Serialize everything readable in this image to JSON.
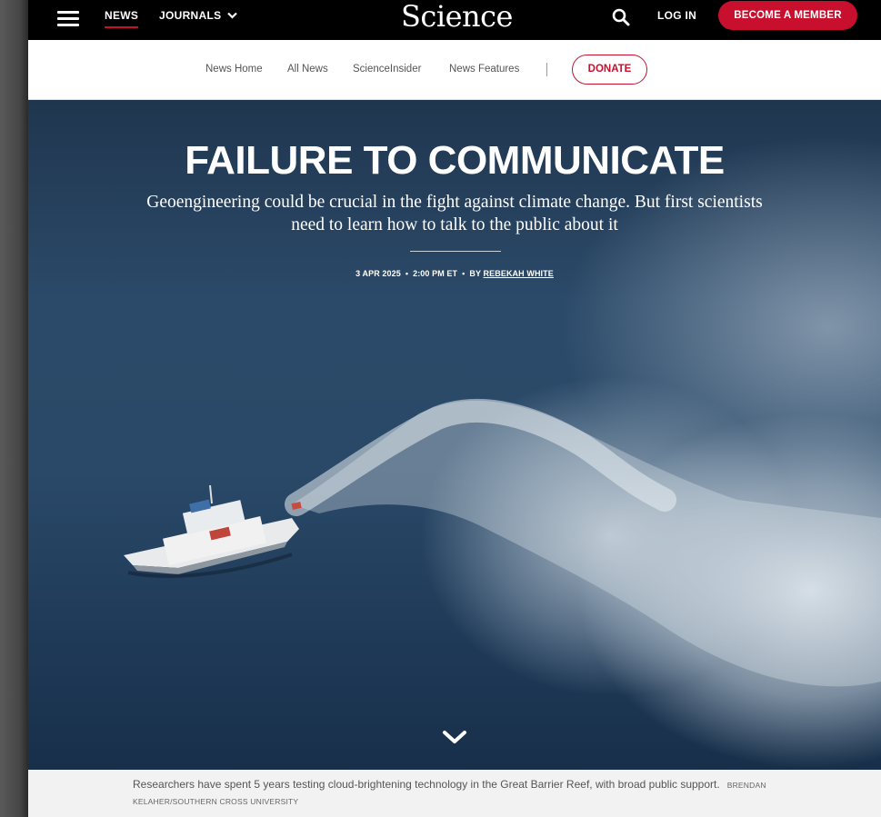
{
  "header": {
    "nav_news": "NEWS",
    "nav_journals": "JOURNALS",
    "logo": "Science",
    "login": "LOG IN",
    "become_member": "BECOME A MEMBER"
  },
  "subnav": {
    "items": [
      "News Home",
      "All News",
      "ScienceInsider",
      "News Features"
    ],
    "donate": "DONATE"
  },
  "hero": {
    "title": "FAILURE TO COMMUNICATE",
    "subtitle": "Geoengineering could be crucial in the fight against climate change. But first scientists need to learn how to talk to the public about it",
    "date": "3 APR 2025",
    "time": "2:00 PM ET",
    "by": "BY",
    "author": "REBEKAH WHITE"
  },
  "caption": {
    "text": "Researchers have spent 5 years testing cloud-brightening technology in the Great Barrier Reef, with broad public support.",
    "credit": "BRENDAN KELAHER/SOUTHERN CROSS UNIVERSITY"
  },
  "colors": {
    "accent": "#c8102e",
    "topbar": "#000000"
  },
  "icons": [
    "hamburger-menu-icon",
    "chevron-down-icon",
    "search-icon",
    "ship-image",
    "scroll-down-chevron-icon"
  ]
}
